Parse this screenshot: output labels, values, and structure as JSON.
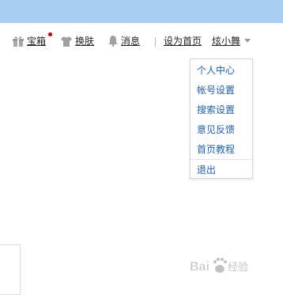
{
  "header": {
    "treasure_label": "宝箱",
    "skin_label": "换肤",
    "message_label": "消息",
    "set_homepage_label": "设为首页",
    "username": "炫小舞"
  },
  "user_menu": {
    "items": [
      "个人中心",
      "帐号设置",
      "搜索设置",
      "意见反馈",
      "首页教程"
    ],
    "logout_label": "退出"
  },
  "colors": {
    "top_bar": "#a9cff3",
    "menu_link": "#1f5fa8",
    "notification_dot": "#d00000"
  },
  "icons": [
    "gift-icon",
    "shirt-icon",
    "bell-icon",
    "caret-down-icon"
  ],
  "watermark": {
    "brand": "Baidu",
    "suffix": "经验"
  }
}
